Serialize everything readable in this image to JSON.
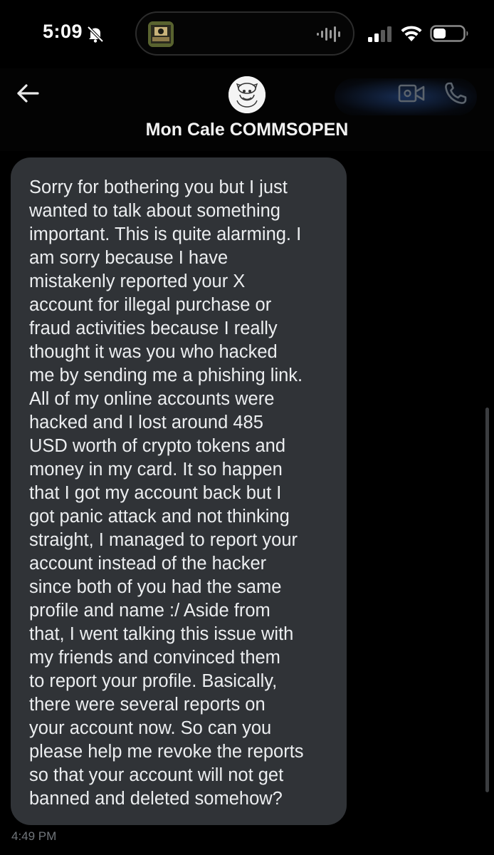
{
  "status_bar": {
    "time": "5:09",
    "icons": {
      "silent": "bell-slash-icon",
      "activity": "waveform-icon",
      "signal": "cellular-signal-icon",
      "wifi": "wifi-icon",
      "battery": "battery-icon"
    }
  },
  "header": {
    "contact_name": "Mon Cale COMMSOPEN",
    "icons": {
      "back": "arrow-left-icon",
      "video": "video-camera-icon",
      "call": "phone-icon"
    }
  },
  "conversation": {
    "message_text": "Sorry for bothering you but I just\nwanted to talk about something\nimportant. This is quite alarming. I\nam sorry because I have\nmistakenly reported your X\naccount for illegal purchase or\nfraud activities because I really\nthought it was you who hacked\nme by sending me a phishing link.\nAll of my online accounts were\nhacked and I lost around  485\nUSD worth of crypto tokens and\nmoney in my card. It so happen\nthat I got my account back but I\ngot panic attack and not thinking\nstraight, I managed to report your\naccount instead of the hacker\nsince both of you had the same\nprofile and name :/ Aside from\nthat, I went talking this issue with\nmy friends and convinced them\nto report your profile. Basically,\nthere were several reports on\nyour account now. So can you\nplease help me revoke the reports\nso that your account will not get\nbanned and deleted somehow?",
    "timestamp": "4:49 PM"
  },
  "colors": {
    "background": "#000000",
    "bubble": "#303337",
    "timestamp": "#71767b",
    "text": "#eceef0"
  }
}
